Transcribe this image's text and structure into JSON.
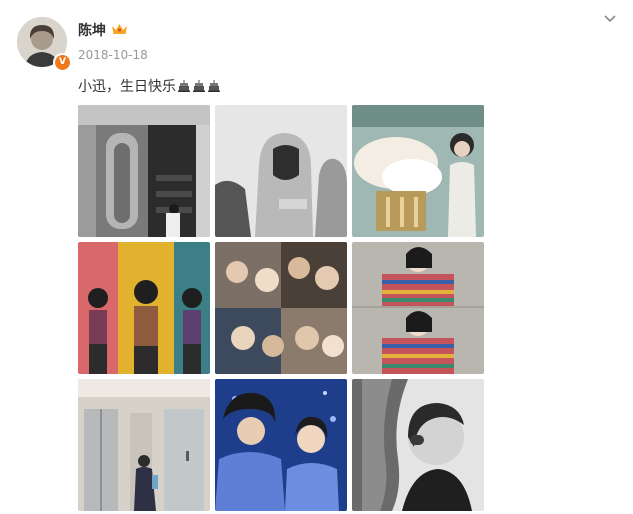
{
  "post": {
    "author": "陈坤",
    "date": "2018-10-18",
    "text": "小迅，生日快乐",
    "cake_icons": [
      "cake-icon",
      "cake-icon",
      "cake-icon"
    ],
    "badge": "V",
    "colors": {
      "badge": "#f07b1f",
      "crown": "#f5a623",
      "meta": "#999999"
    }
  },
  "photos": [
    {
      "name": "photo-door-bw",
      "icon": "photo"
    },
    {
      "name": "photo-hooded-bw",
      "icon": "photo"
    },
    {
      "name": "photo-chandelier",
      "icon": "photo"
    },
    {
      "name": "photo-color-triptych",
      "icon": "photo"
    },
    {
      "name": "photo-collage",
      "icon": "photo"
    },
    {
      "name": "photo-striped-sweater",
      "icon": "photo"
    },
    {
      "name": "photo-elevator-hallway",
      "icon": "photo"
    },
    {
      "name": "photo-blue-hoodies",
      "icon": "photo"
    },
    {
      "name": "photo-profile-bw",
      "icon": "photo"
    }
  ]
}
